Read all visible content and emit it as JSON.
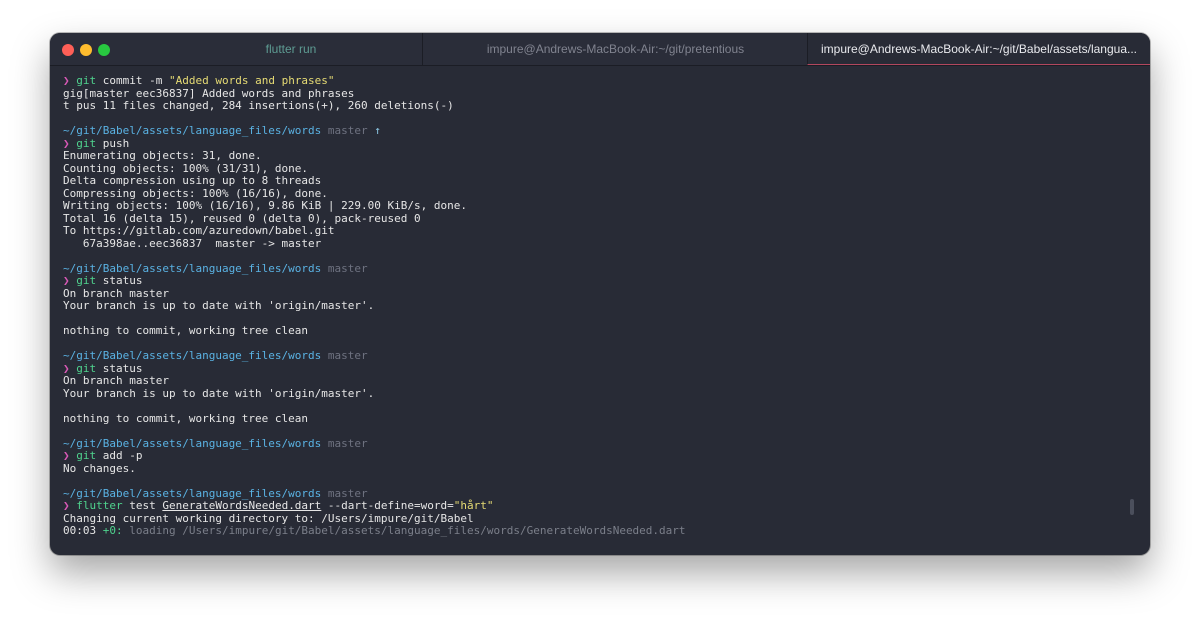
{
  "window": {
    "tabs": [
      {
        "label": "flutter run"
      },
      {
        "label": "impure@Andrews-MacBook-Air:~/git/pretentious"
      },
      {
        "label": "impure@Andrews-MacBook-Air:~/git/Babel/assets/langua..."
      }
    ],
    "traffic_lights": {
      "close": "#fe5f57",
      "minimize": "#febc2e",
      "zoom": "#28c840"
    }
  },
  "colors": {
    "background": "#282b36",
    "prompt_symbol": "#d859b6",
    "command": "#4fd38e",
    "string": "#e6db74",
    "path": "#5ab2e3",
    "branch": "#6e7280",
    "active_tab_underline": "#b2475e"
  },
  "terminal": {
    "prompt_symbol": "❯",
    "path": "~/git/Babel/assets/language_files/words",
    "branch": "master",
    "ahead_arrow": "↑",
    "b1": {
      "cmd": "git",
      "args": " commit -m ",
      "msg": "\"Added words and phrases\"",
      "out1": "gig[master eec36837] Added words and phrases",
      "out2": "t pus 11 files changed, 284 insertions(+), 260 deletions(-)"
    },
    "b2": {
      "cmd": "git",
      "args": " push",
      "out": [
        "Enumerating objects: 31, done.",
        "Counting objects: 100% (31/31), done.",
        "Delta compression using up to 8 threads",
        "Compressing objects: 100% (16/16), done.",
        "Writing objects: 100% (16/16), 9.86 KiB | 229.00 KiB/s, done.",
        "Total 16 (delta 15), reused 0 (delta 0), pack-reused 0",
        "To https://gitlab.com/azuredown/babel.git",
        "   67a398ae..eec36837  master -> master"
      ]
    },
    "b3": {
      "cmd": "git",
      "args": " status",
      "out1": "On branch master",
      "out2": "Your branch is up to date with 'origin/master'.",
      "out3": "nothing to commit, working tree clean"
    },
    "b4": {
      "cmd": "git",
      "args": " status",
      "out1": "On branch master",
      "out2": "Your branch is up to date with 'origin/master'.",
      "out3": "nothing to commit, working tree clean"
    },
    "b5": {
      "cmd": "git",
      "args": " add -p",
      "out": "No changes."
    },
    "b6": {
      "cmd": "flutter",
      "a1": " test ",
      "file": "GenerateWordsNeeded.dart",
      "a2": " --dart-define=word=",
      "val": "\"hårt\"",
      "out": "Changing current working directory to: /Users/impure/git/Babel",
      "time": "00:03 ",
      "count": "+0:",
      "loading": " loading /Users/impure/git/Babel/assets/language_files/words/GenerateWordsNeeded.dart"
    }
  }
}
